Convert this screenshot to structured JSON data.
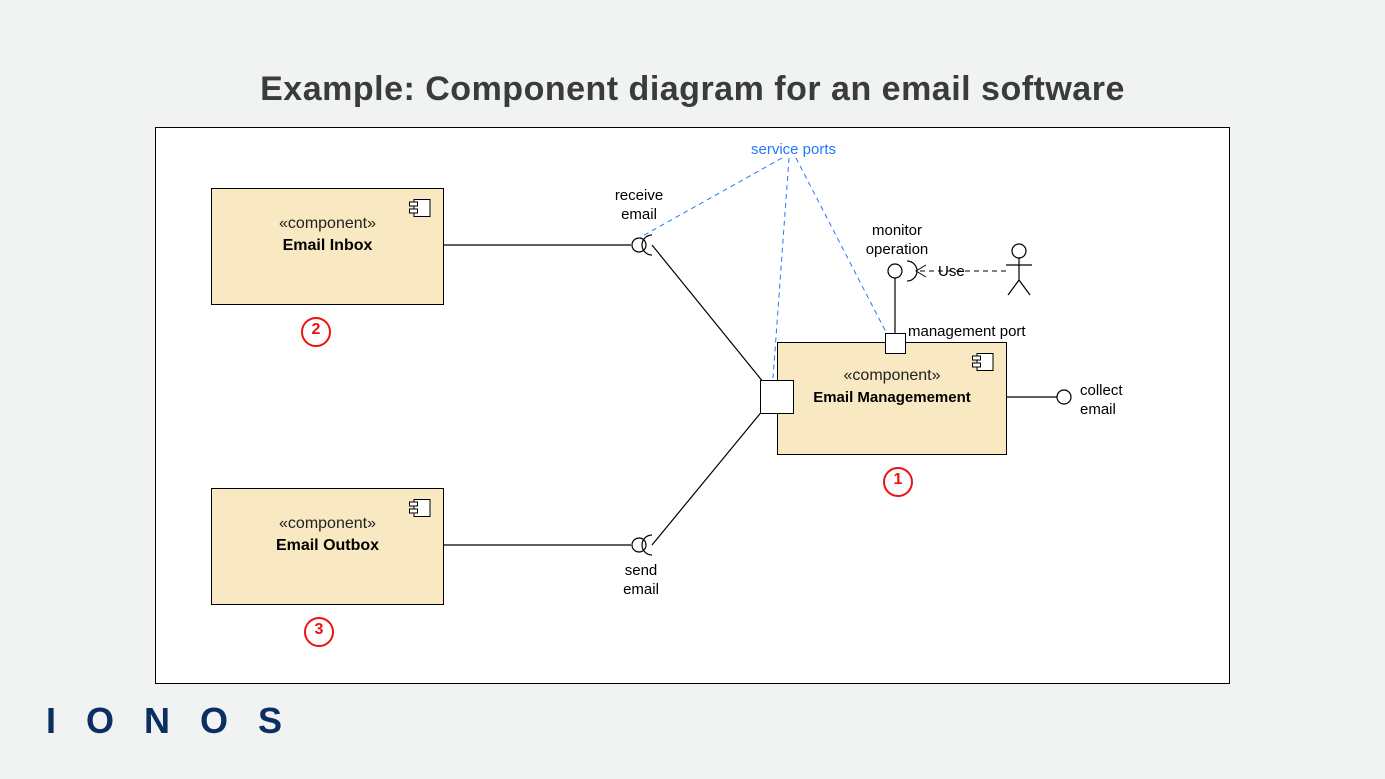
{
  "title": "Example: Component diagram for an email software",
  "logo": "I O N O S",
  "annotations": {
    "service_ports": "service ports",
    "management_port": "management port",
    "monitor_op_l1": "monitor",
    "monitor_op_l2": "operation",
    "use": "Use",
    "receive_l1": "receive",
    "receive_l2": "email",
    "send_l1": "send",
    "send_l2": "email",
    "collect_l1": "collect",
    "collect_l2": "email"
  },
  "components": {
    "inbox": {
      "stereo": "«component»",
      "name": "Email Inbox",
      "num": "2"
    },
    "outbox": {
      "stereo": "«component»",
      "name": "Email Outbox",
      "num": "3"
    },
    "mgmt": {
      "stereo": "«component»",
      "name": "Email Managemement",
      "num": "1"
    }
  }
}
